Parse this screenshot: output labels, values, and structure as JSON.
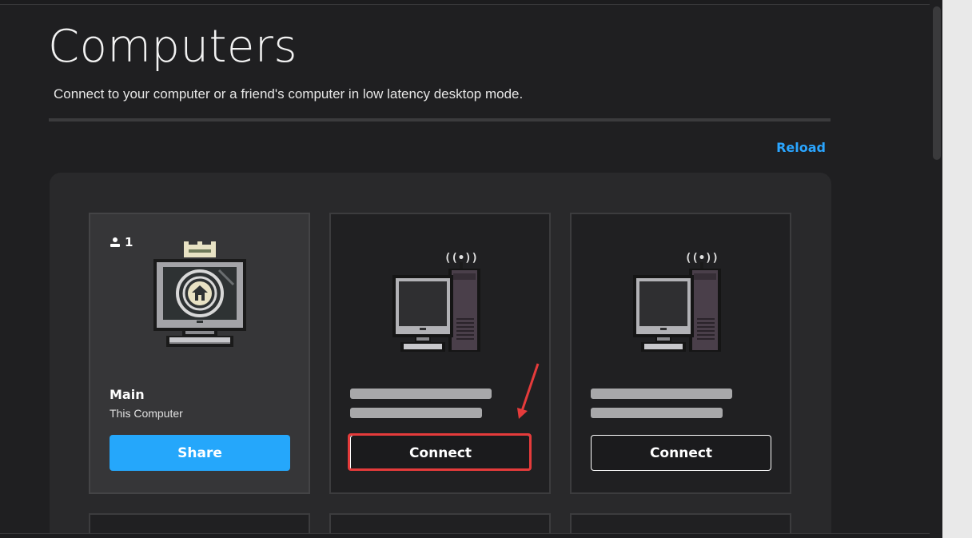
{
  "page": {
    "title": "Computers",
    "subtitle": "Connect to your computer or a friend's computer in low latency desktop mode.",
    "reload_label": "Reload"
  },
  "cards": [
    {
      "type": "main",
      "user_count": "1",
      "name": "Main",
      "subtitle": "This Computer",
      "button_label": "Share",
      "icon": "home-monitor-icon"
    },
    {
      "type": "remote",
      "name": "",
      "subtitle": "",
      "button_label": "Connect",
      "icon": "desktop-tower-icon",
      "highlighted": true
    },
    {
      "type": "remote",
      "name": "",
      "subtitle": "",
      "button_label": "Connect",
      "icon": "desktop-tower-icon"
    }
  ],
  "colors": {
    "accent": "#25a7fb",
    "link": "#2aa5ff",
    "highlight": "#e53b3b",
    "background": "#1f1f21",
    "panel": "#29292b"
  }
}
